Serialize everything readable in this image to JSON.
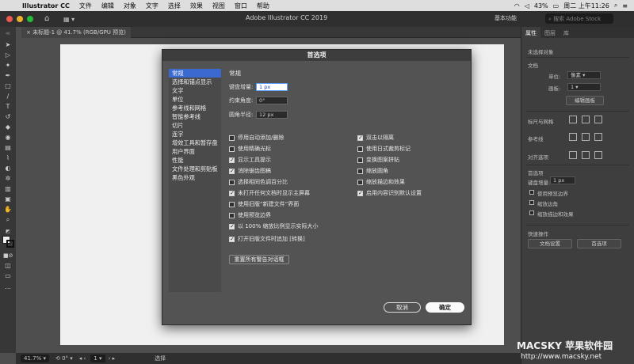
{
  "menubar": {
    "app": "Illustrator CC",
    "items": [
      "文件",
      "编辑",
      "对象",
      "文字",
      "选择",
      "效果",
      "视图",
      "窗口",
      "帮助"
    ],
    "battery": "43%",
    "clock": "周二 上午11:26"
  },
  "appbar": {
    "title": "Adobe Illustrator CC 2019",
    "workspace": "基本功能",
    "stock_placeholder": "搜索 Adobe Stock"
  },
  "document": {
    "tab": "未标题-1 @ 41.7% (RGB/GPU 预览)"
  },
  "statusbar": {
    "zoom": "41.7%",
    "page": "1",
    "tool": "选择"
  },
  "panel": {
    "tabs": [
      "属性",
      "图层",
      "库"
    ],
    "no_selection": "未选择对象",
    "doc_label": "文档",
    "units_label": "单位:",
    "units_value": "像素",
    "artboard_label": "画板:",
    "artboard_value": "1",
    "edit_artboard": "编辑画板",
    "rulers_grids": "标尺与网格",
    "guides": "参考线",
    "align": "对齐选项",
    "prefs": "首选项",
    "kbd_inc_label": "键盘增量:",
    "kbd_inc_value": "1 px",
    "opt_preview_bounds": "使用预览边界",
    "opt_scale_corners": "缩放边角",
    "opt_scale_strokes": "缩放描边和效果",
    "quick_actions": "快速操作",
    "doc_setup": "文档设置",
    "preferences_btn": "首选项"
  },
  "dialog": {
    "title": "首选项",
    "nav": [
      "常规",
      "选择和锚点显示",
      "文字",
      "单位",
      "参考线和网格",
      "智能参考线",
      "切片",
      "连字",
      "增效工具和暂存盘",
      "用户界面",
      "性能",
      "文件处理和剪贴板",
      "黑色外观"
    ],
    "section": "常规",
    "keyboard_increment_label": "键盘增量:",
    "keyboard_increment": "1 px",
    "constrain_angle_label": "约束角度:",
    "constrain_angle": "0°",
    "corner_radius_label": "圆角半径:",
    "corner_radius": "12 px",
    "left_options": [
      {
        "label": "停用自动添加/删除",
        "checked": false
      },
      {
        "label": "使用精确光标",
        "checked": false
      },
      {
        "label": "显示工具提示",
        "checked": true
      },
      {
        "label": "消除锯齿图稿",
        "checked": true
      },
      {
        "label": "选择相同色调百分比",
        "checked": false
      },
      {
        "label": "未打开任何文档时显示主屏幕",
        "checked": true
      },
      {
        "label": "使用旧版“新建文件”界面",
        "checked": false
      },
      {
        "label": "使用预览边界",
        "checked": false
      },
      {
        "label": "以 100% 缩放比例显示实际大小",
        "checked": true
      },
      {
        "label": "打开旧版文件时追加 [转换]",
        "checked": true
      }
    ],
    "right_options": [
      {
        "label": "双击以隔离",
        "checked": true
      },
      {
        "label": "使用日式裁剪标记",
        "checked": false
      },
      {
        "label": "变换图案拼贴",
        "checked": false
      },
      {
        "label": "缩放圆角",
        "checked": false
      },
      {
        "label": "缩放描边和效果",
        "checked": false
      },
      {
        "label": "启用内容识别默认设置",
        "checked": true
      }
    ],
    "reset_warnings": "重置所有警告对话框",
    "cancel": "取消",
    "ok": "确定"
  },
  "watermark": {
    "brand": "MACSKY 苹果软件园",
    "url": "http://www.macsky.net"
  }
}
